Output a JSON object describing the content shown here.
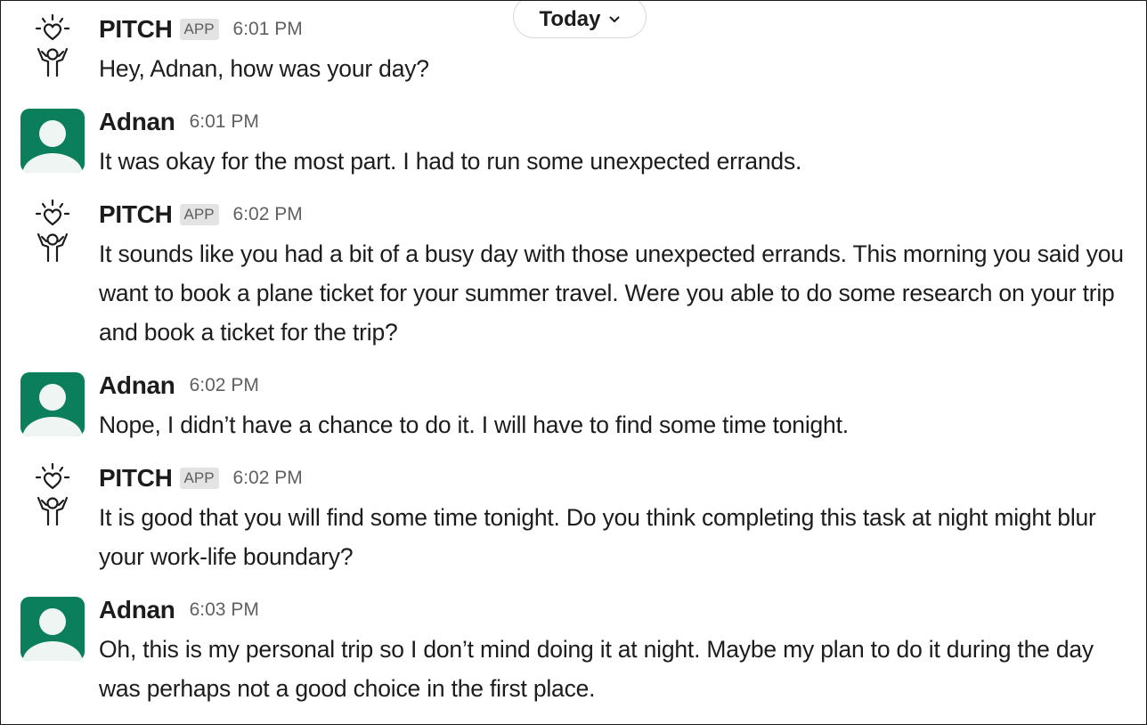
{
  "date_divider": {
    "label": "Today",
    "icon": "chevron-down-icon"
  },
  "messages": [
    {
      "sender": "PITCH",
      "badge": "APP",
      "time": "6:01 PM",
      "avatar": "pitch-logo-icon",
      "text": "Hey, Adnan, how was your day?"
    },
    {
      "sender": "Adnan",
      "time": "6:01 PM",
      "avatar": "user-avatar-icon",
      "text": "It was okay for the most part. I had to run some unexpected errands."
    },
    {
      "sender": "PITCH",
      "badge": "APP",
      "time": "6:02 PM",
      "avatar": "pitch-logo-icon",
      "text": "It sounds like you had a bit of a busy day with those unexpected errands. This morning you said you want to book a plane ticket for your summer travel. Were you able to do some research on your trip and book a ticket for the trip?"
    },
    {
      "sender": "Adnan",
      "time": "6:02 PM",
      "avatar": "user-avatar-icon",
      "text": "Nope, I didn’t have a chance to do it. I will have to find some time tonight."
    },
    {
      "sender": "PITCH",
      "badge": "APP",
      "time": "6:02 PM",
      "avatar": "pitch-logo-icon",
      "text": "It is good that you will find some time tonight. Do you think completing this task at night might blur your work-life boundary?"
    },
    {
      "sender": "Adnan",
      "time": "6:03 PM",
      "avatar": "user-avatar-icon",
      "text": "Oh, this is my personal trip so I don’t mind doing it at night. Maybe my plan to do it during the day was perhaps not a good choice in the first place."
    }
  ],
  "colors": {
    "user_avatar_bg": "#0b7f5c",
    "user_avatar_fg": "#eef5f2",
    "text": "#1d1c1d",
    "timestamp": "#616061",
    "badge_bg": "#e3e3e3",
    "badge_fg": "#5e5e5e"
  }
}
